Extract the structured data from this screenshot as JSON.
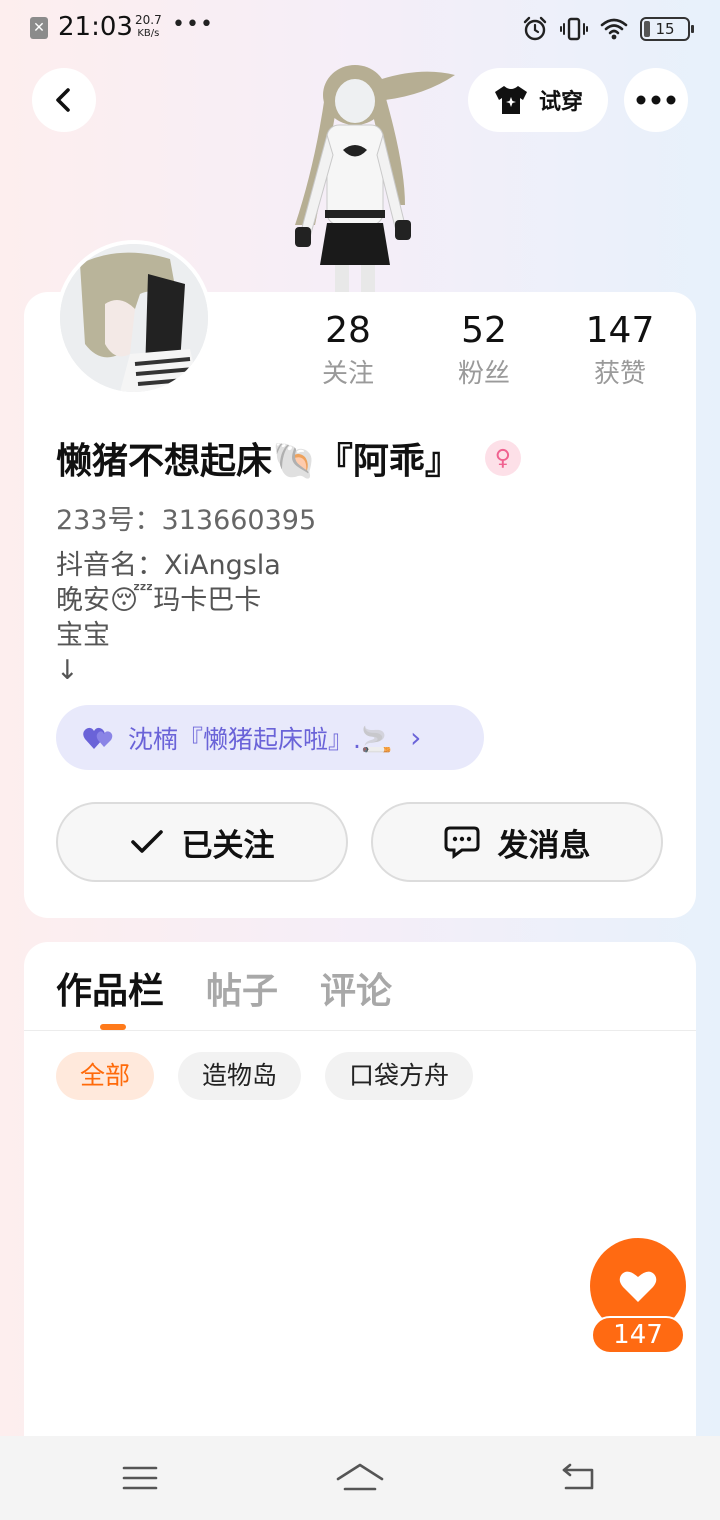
{
  "status_bar": {
    "time": "21:03",
    "speed_value": "20.7",
    "speed_unit": "KB/s",
    "more": "•••",
    "battery": "15",
    "icons": [
      "alarm-icon",
      "vibrate-icon",
      "wifi-icon",
      "battery-icon"
    ]
  },
  "header": {
    "back_icon": "chevron-left-icon",
    "try_on_label": "试穿",
    "try_on_icon": "shirt-icon",
    "more_icon": "more-horizontal-icon"
  },
  "profile": {
    "username": "懒猪不想起床🐚『阿乖』",
    "gender_icon": "female-icon",
    "uid": "233号：313660395",
    "bio": "抖音名：XiAngsla\n晚安😴玛卡巴卡\n宝宝\n↓",
    "stats": [
      {
        "value": "28",
        "label": "关注"
      },
      {
        "value": "52",
        "label": "粉丝"
      },
      {
        "value": "147",
        "label": "获赞"
      }
    ],
    "relation": {
      "text": "沈楠『懒猪起床啦』.🚬",
      "icon": "hearts-icon"
    },
    "follow_button": "已关注",
    "message_button": "发消息"
  },
  "content": {
    "tabs": [
      {
        "label": "作品栏",
        "active": true
      },
      {
        "label": "帖子",
        "active": false
      },
      {
        "label": "评论",
        "active": false
      }
    ],
    "filters": [
      {
        "label": "全部",
        "active": true
      },
      {
        "label": "造物岛",
        "active": false
      },
      {
        "label": "口袋方舟",
        "active": false
      }
    ]
  },
  "like_fab": {
    "count": "147",
    "icon": "heart-icon"
  },
  "nav_bar": {
    "icons": [
      "menu-icon",
      "home-icon",
      "back-icon"
    ]
  },
  "colors": {
    "accent": "#ff6a12",
    "relation": "#6a63d8",
    "relation_bg": "#e8e9fb"
  }
}
